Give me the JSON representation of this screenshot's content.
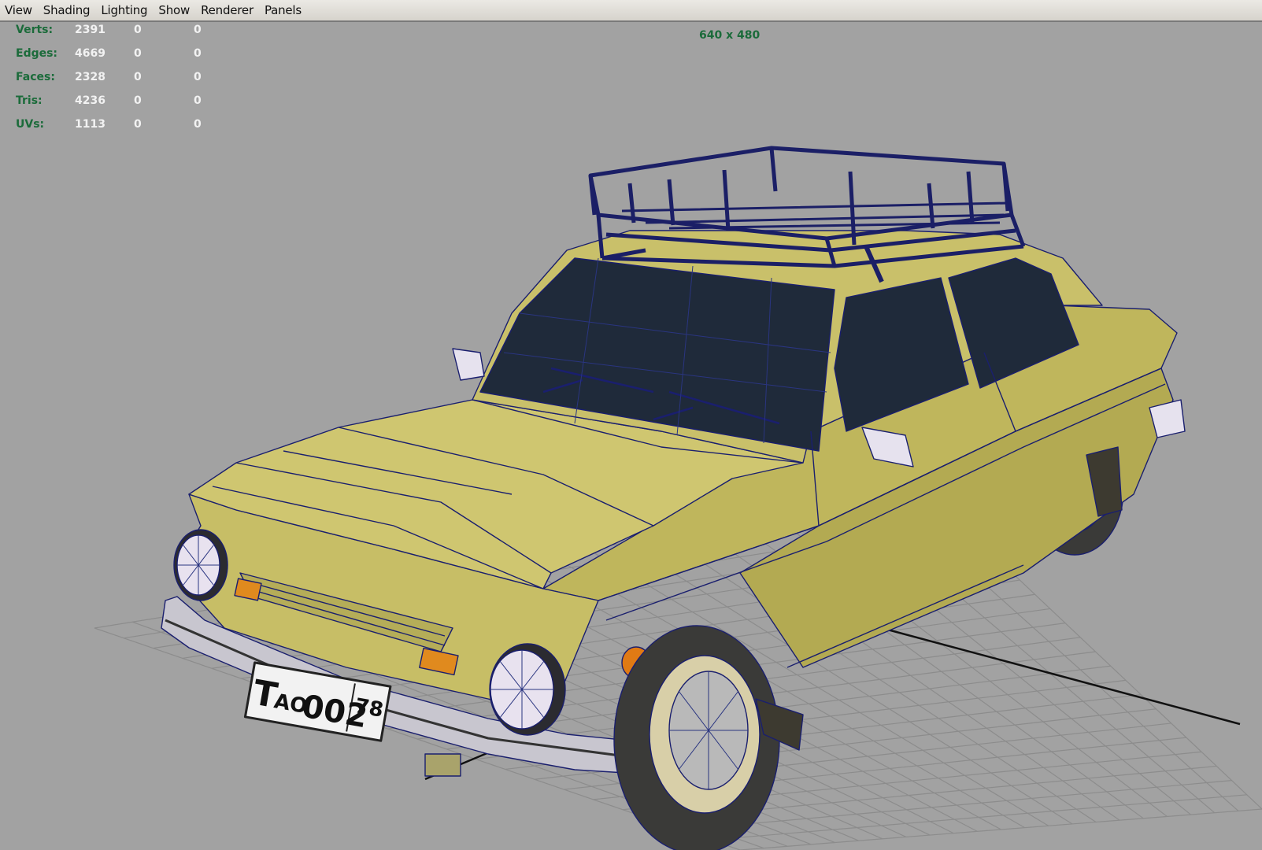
{
  "menu": {
    "items": [
      "View",
      "Shading",
      "Lighting",
      "Show",
      "Renderer",
      "Panels"
    ]
  },
  "hud": {
    "rows": [
      {
        "label": "Verts:",
        "values": [
          "2391",
          "0",
          "0"
        ]
      },
      {
        "label": "Edges:",
        "values": [
          "4669",
          "0",
          "0"
        ]
      },
      {
        "label": "Faces:",
        "values": [
          "2328",
          "0",
          "0"
        ]
      },
      {
        "label": "Tris:",
        "values": [
          "4236",
          "0",
          "0"
        ]
      },
      {
        "label": "UVs:",
        "values": [
          "1113",
          "0",
          "0"
        ]
      }
    ],
    "resolution": "640 x 480"
  },
  "plate": {
    "letter": "T",
    "series": "AO",
    "number": "002",
    "region": "78"
  },
  "colors": {
    "viewport_bg": "#a2a2a2",
    "car_body": "#c9c06a",
    "wireframe": "#1a1f6e",
    "window_glass": "#1f2a3a",
    "hud_label": "#1b6b3a"
  }
}
